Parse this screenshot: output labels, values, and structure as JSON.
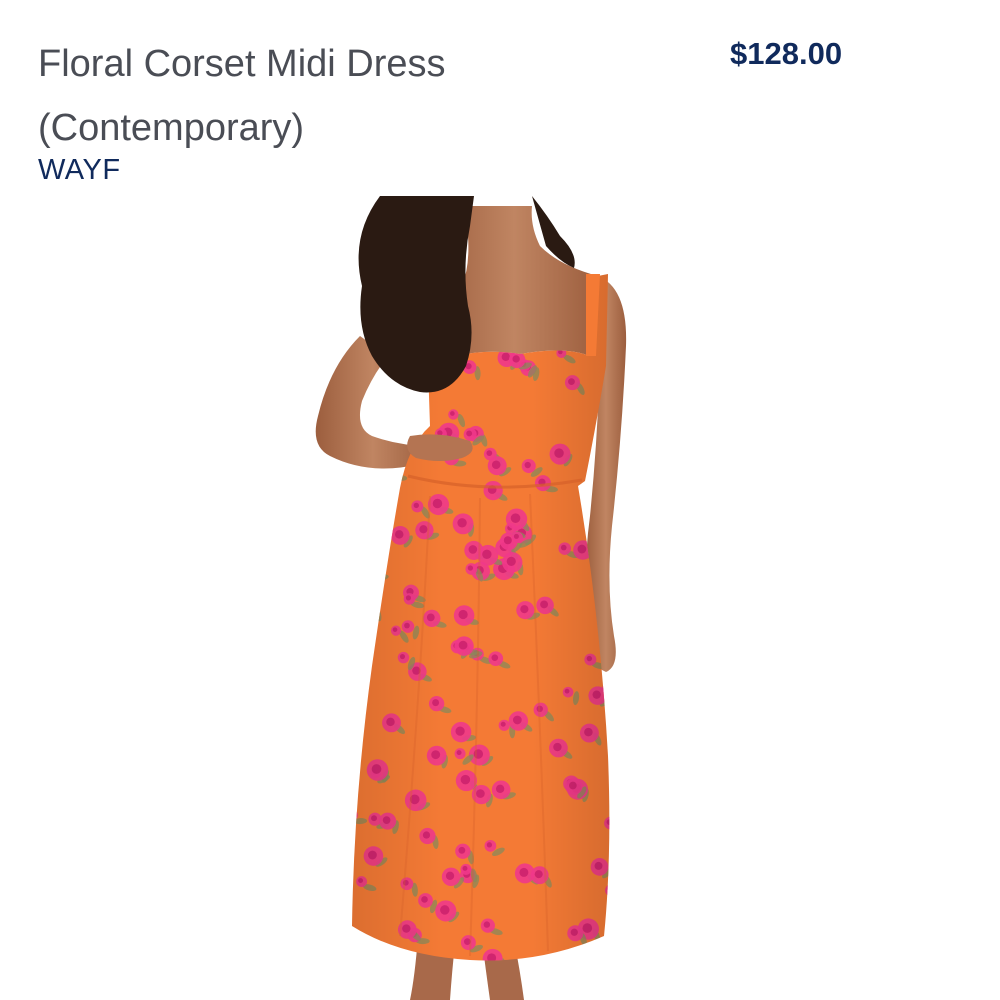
{
  "product": {
    "title_line1": "Floral Corset Midi Dress",
    "title_line2": "(Contemporary)",
    "brand": "WAYF",
    "price": "$128.00"
  },
  "image": {
    "subject": "model-wearing-orange-floral-dress",
    "dress_color": "#f47a35",
    "flower_color": "#f0388a",
    "leaf_color": "#8a8a5a",
    "skin_color": "#b0714c",
    "hair_color": "#2a1a12"
  },
  "colors": {
    "title": "#4a4d55",
    "accent": "#102a5c",
    "background": "#ffffff"
  }
}
